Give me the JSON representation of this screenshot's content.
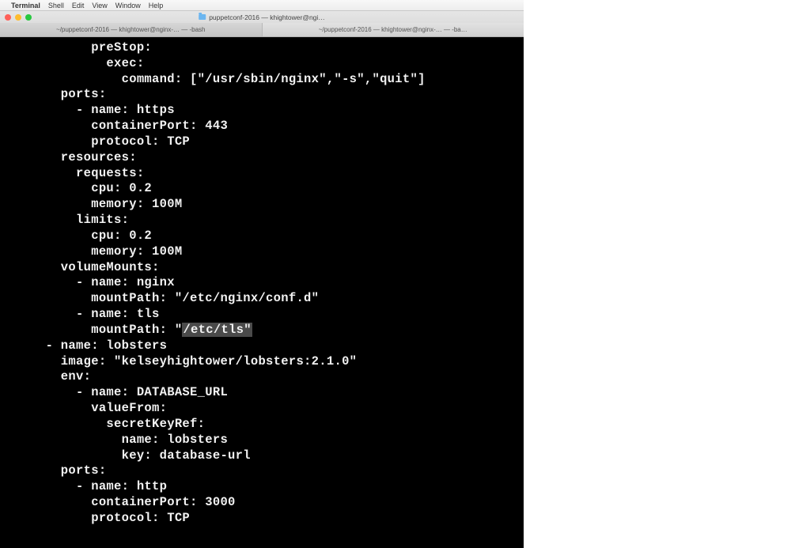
{
  "menubar": {
    "app": "Terminal",
    "items": [
      "Shell",
      "Edit",
      "View",
      "Window",
      "Help"
    ]
  },
  "window": {
    "title": "puppetconf-2016 — khightower@ngi…"
  },
  "tabs": [
    {
      "label": "~/puppetconf-2016 — khightower@nginx-… — -bash"
    },
    {
      "label": "~/puppetconf-2016 — khightower@nginx-… — -ba…"
    }
  ],
  "code": {
    "lines": [
      {
        "indent": 12,
        "text": "preStop:"
      },
      {
        "indent": 14,
        "text": "exec:"
      },
      {
        "indent": 16,
        "text": "command: [\"/usr/sbin/nginx\",\"-s\",\"quit\"]"
      },
      {
        "indent": 8,
        "text": "ports:"
      },
      {
        "indent": 10,
        "text": "- name: https"
      },
      {
        "indent": 12,
        "text": "containerPort: 443"
      },
      {
        "indent": 12,
        "text": "protocol: TCP"
      },
      {
        "indent": 8,
        "text": "resources:"
      },
      {
        "indent": 10,
        "text": "requests:"
      },
      {
        "indent": 12,
        "text": "cpu: 0.2"
      },
      {
        "indent": 12,
        "text": "memory: 100M"
      },
      {
        "indent": 10,
        "text": "limits:"
      },
      {
        "indent": 12,
        "text": "cpu: 0.2"
      },
      {
        "indent": 12,
        "text": "memory: 100M"
      },
      {
        "indent": 8,
        "text": "volumeMounts:"
      },
      {
        "indent": 10,
        "text": "- name: nginx"
      },
      {
        "indent": 12,
        "text": "mountPath: \"/etc/nginx/conf.d\""
      },
      {
        "indent": 10,
        "text": "- name: tls"
      },
      {
        "indent": 12,
        "prefix": "mountPath: \"",
        "highlight": "/etc/tls\""
      },
      {
        "indent": 6,
        "text": "- name: lobsters"
      },
      {
        "indent": 8,
        "text": "image: \"kelseyhightower/lobsters:2.1.0\""
      },
      {
        "indent": 8,
        "text": "env:"
      },
      {
        "indent": 10,
        "text": "- name: DATABASE_URL"
      },
      {
        "indent": 12,
        "text": "valueFrom:"
      },
      {
        "indent": 14,
        "text": "secretKeyRef:"
      },
      {
        "indent": 16,
        "text": "name: lobsters"
      },
      {
        "indent": 16,
        "text": "key: database-url"
      },
      {
        "indent": 8,
        "text": "ports:"
      },
      {
        "indent": 10,
        "text": "- name: http"
      },
      {
        "indent": 12,
        "text": "containerPort: 3000"
      },
      {
        "indent": 12,
        "text": "protocol: TCP"
      }
    ]
  }
}
